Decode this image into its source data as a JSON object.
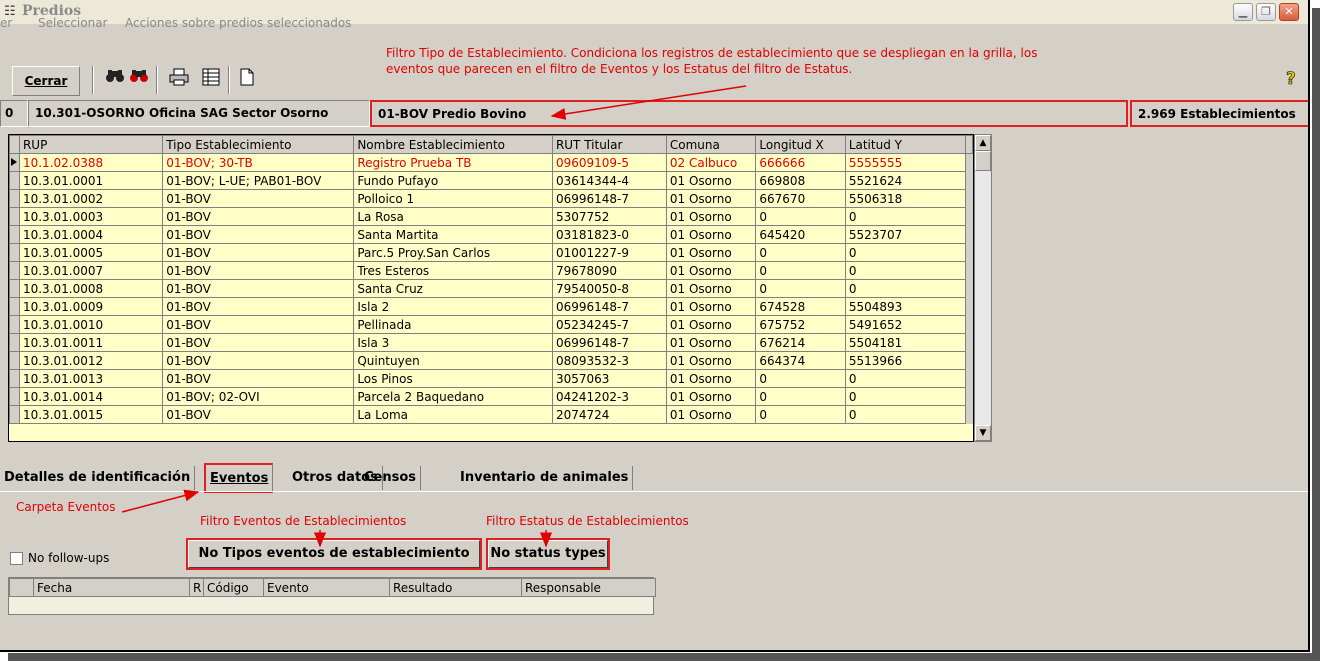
{
  "window": {
    "title": "Predios",
    "icon": "app-icon"
  },
  "menu": {
    "items": [
      "Ver",
      "Seleccionar",
      "Acciones sobre predios seleccionados"
    ],
    "visible_first": "er"
  },
  "toolbar": {
    "close_label": "Cerrar",
    "icons": [
      "binoculars-icon",
      "binoculars-red-icon",
      "printer-icon",
      "grid-icon",
      "new-document-icon",
      "help-icon"
    ]
  },
  "annotations": {
    "filtro_tipo_line1": "Filtro Tipo de Establecimiento. Condiciona los registros de establecimiento que se despliegan en la grilla, los",
    "filtro_tipo_line2": "eventos que parecen en el filtro de Eventos y los Estatus del filtro de Estatus.",
    "carpeta_eventos": "Carpeta Eventos",
    "filtro_eventos": "Filtro Eventos de Establecimientos",
    "filtro_estatus": "Filtro Estatus de Establecimientos"
  },
  "infobar": {
    "index": "0",
    "office": "10.301-OSORNO Oficina SAG Sector Osorno",
    "tipo_filter": "01-BOV Predio Bovino",
    "count": "2.969 Establecimientos"
  },
  "grid": {
    "columns": [
      "RUP",
      "Tipo Establecimiento",
      "Nombre Establecimiento",
      "RUT Titular",
      "Comuna",
      "Longitud X",
      "Latitud Y"
    ],
    "rows": [
      [
        "10.1.02.0388",
        "01-BOV; 30-TB",
        "Registro Prueba TB",
        "09609109-5",
        "02 Calbuco",
        "666666",
        "5555555"
      ],
      [
        "10.3.01.0001",
        "01-BOV; L-UE; PAB01-BOV",
        "Fundo Pufayo",
        "03614344-4",
        "01 Osorno",
        "669808",
        "5521624"
      ],
      [
        "10.3.01.0002",
        "01-BOV",
        "Polloico 1",
        "06996148-7",
        "01 Osorno",
        "667670",
        "5506318"
      ],
      [
        "10.3.01.0003",
        "01-BOV",
        "La Rosa",
        "5307752",
        "01 Osorno",
        "0",
        "0"
      ],
      [
        "10.3.01.0004",
        "01-BOV",
        "Santa Martita",
        "03181823-0",
        "01 Osorno",
        "645420",
        "5523707"
      ],
      [
        "10.3.01.0005",
        "01-BOV",
        "Parc.5 Proy.San Carlos",
        "01001227-9",
        "01 Osorno",
        "0",
        "0"
      ],
      [
        "10.3.01.0007",
        "01-BOV",
        "Tres Esteros",
        "79678090",
        "01 Osorno",
        "0",
        "0"
      ],
      [
        "10.3.01.0008",
        "01-BOV",
        "Santa Cruz",
        "79540050-8",
        "01 Osorno",
        "0",
        "0"
      ],
      [
        "10.3.01.0009",
        "01-BOV",
        "Isla 2",
        "06996148-7",
        "01 Osorno",
        "674528",
        "5504893"
      ],
      [
        "10.3.01.0010",
        "01-BOV",
        "Pellinada",
        "05234245-7",
        "01 Osorno",
        "675752",
        "5491652"
      ],
      [
        "10.3.01.0011",
        "01-BOV",
        "Isla 3",
        "06996148-7",
        "01 Osorno",
        "676214",
        "5504181"
      ],
      [
        "10.3.01.0012",
        "01-BOV",
        "Quintuyen",
        "08093532-3",
        "01 Osorno",
        "664374",
        "5513966"
      ],
      [
        "10.3.01.0013",
        "01-BOV",
        "Los Pinos",
        "3057063",
        "01 Osorno",
        "0",
        "0"
      ],
      [
        "10.3.01.0014",
        "01-BOV; 02-OVI",
        "Parcela 2 Baquedano",
        "04241202-3",
        "01 Osorno",
        "0",
        "0"
      ],
      [
        "10.3.01.0015",
        "01-BOV",
        "La Loma",
        "2074724",
        "01 Osorno",
        "0",
        "0"
      ]
    ]
  },
  "tabs": [
    "Detalles de identificación",
    "Eventos",
    "Otros datos",
    "Censos",
    "Inventario de animales"
  ],
  "events_panel": {
    "no_followups": "No follow-ups",
    "eventos_filter": "No Tipos eventos de establecimiento",
    "status_filter": "No status types",
    "columns": [
      "Fecha",
      "R",
      "Código",
      "Evento",
      "Resultado",
      "Responsable"
    ]
  },
  "colors": {
    "annotation": "#e00000",
    "grid_bg": "#ffffc8",
    "window_bg": "#d4d0c8"
  }
}
